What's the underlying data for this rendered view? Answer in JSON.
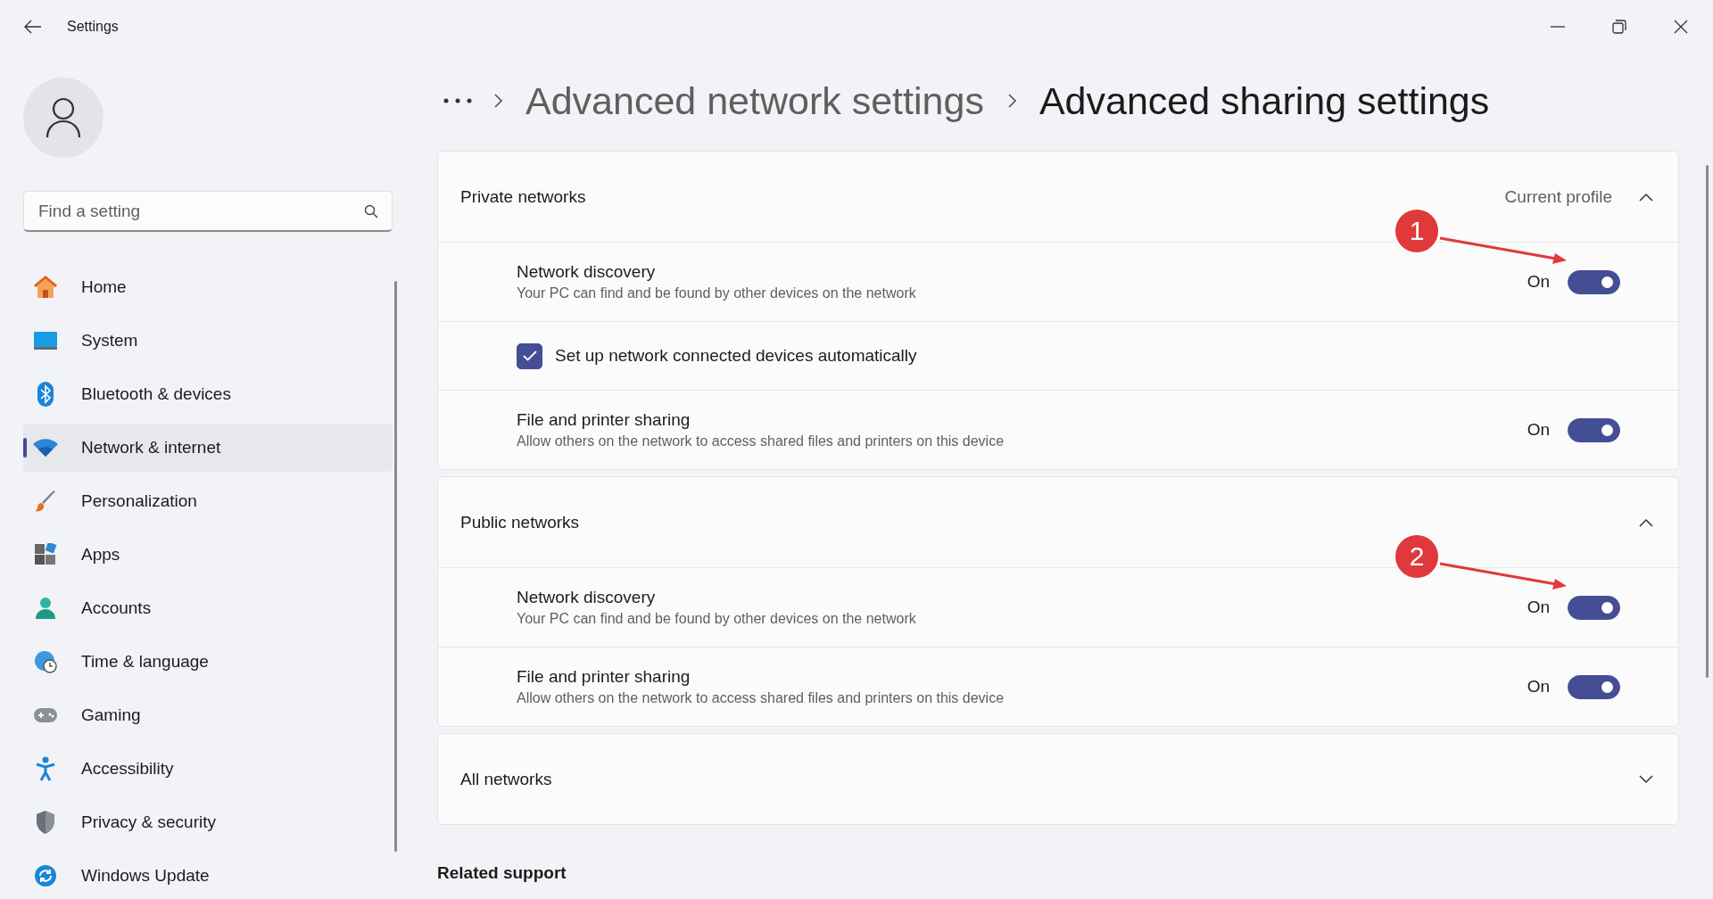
{
  "window": {
    "title": "Settings"
  },
  "search": {
    "placeholder": "Find a setting"
  },
  "sidebar": {
    "items": [
      {
        "label": "Home",
        "kind": "home",
        "selected": false
      },
      {
        "label": "System",
        "kind": "system",
        "selected": false
      },
      {
        "label": "Bluetooth & devices",
        "kind": "bluetooth",
        "selected": false
      },
      {
        "label": "Network & internet",
        "kind": "network",
        "selected": true
      },
      {
        "label": "Personalization",
        "kind": "brush",
        "selected": false
      },
      {
        "label": "Apps",
        "kind": "apps",
        "selected": false
      },
      {
        "label": "Accounts",
        "kind": "accounts",
        "selected": false
      },
      {
        "label": "Time & language",
        "kind": "time",
        "selected": false
      },
      {
        "label": "Gaming",
        "kind": "gaming",
        "selected": false
      },
      {
        "label": "Accessibility",
        "kind": "accessibility",
        "selected": false
      },
      {
        "label": "Privacy & security",
        "kind": "privacy",
        "selected": false
      },
      {
        "label": "Windows Update",
        "kind": "update",
        "selected": false
      }
    ]
  },
  "breadcrumb": [
    {
      "label": "Advanced network settings",
      "selected": false
    },
    {
      "label": "Advanced sharing settings",
      "selected": true
    }
  ],
  "sections": [
    {
      "title": "Private networks",
      "badge": "Current profile",
      "expanded": true,
      "rows": [
        {
          "kind": "toggle",
          "title": "Network discovery",
          "description": "Your PC can find and be found by other devices on the network",
          "state_text": "On",
          "on": true,
          "callout": "1"
        },
        {
          "kind": "checkbox",
          "label": "Set up network connected devices automatically",
          "checked": true
        },
        {
          "kind": "toggle",
          "title": "File and printer sharing",
          "description": "Allow others on the network to access shared files and printers on this device",
          "state_text": "On",
          "on": true
        }
      ]
    },
    {
      "title": "Public networks",
      "expanded": true,
      "rows": [
        {
          "kind": "toggle",
          "title": "Network discovery",
          "description": "Your PC can find and be found by other devices on the network",
          "state_text": "On",
          "on": true,
          "callout": "2"
        },
        {
          "kind": "toggle",
          "title": "File and printer sharing",
          "description": "Allow others on the network to access shared files and printers on this device",
          "state_text": "On",
          "on": true
        }
      ]
    },
    {
      "title": "All networks",
      "expanded": false
    }
  ],
  "related_support": {
    "title": "Related support"
  }
}
